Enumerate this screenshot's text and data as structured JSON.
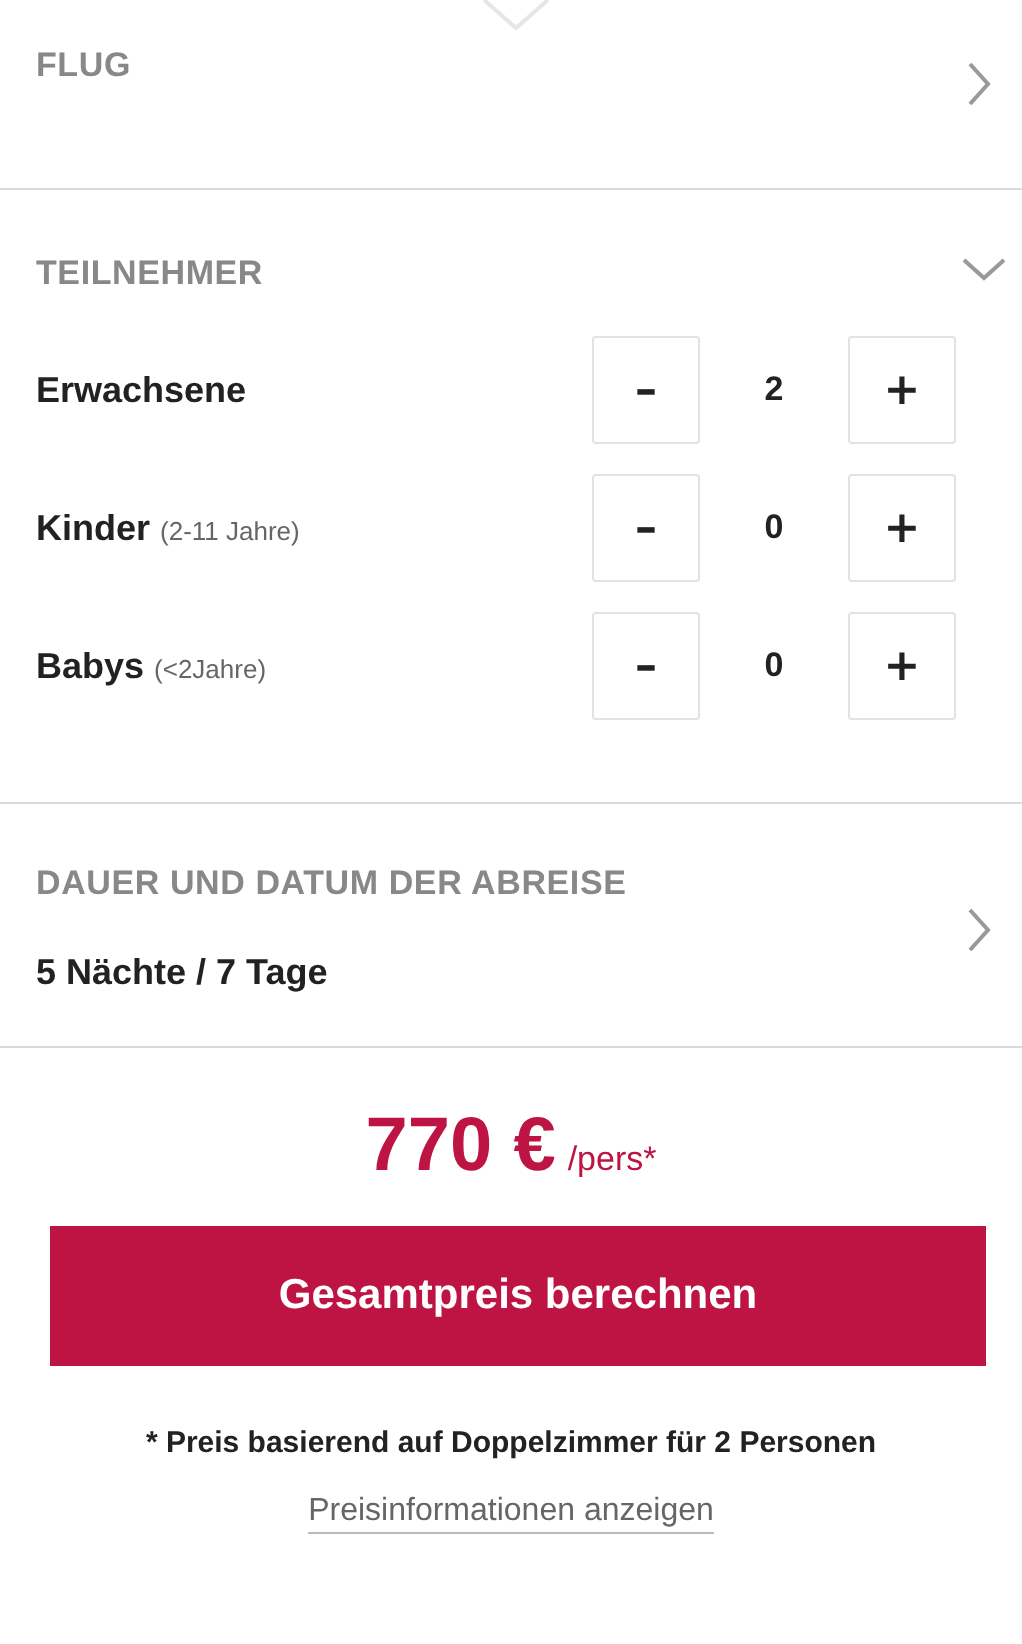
{
  "sections": [
    {
      "title": "FLUG",
      "expanded": false
    },
    {
      "title": "TEILNEHMER",
      "expanded": true,
      "participants": [
        {
          "label": "Erwachsene",
          "minus": "–",
          "count": "2",
          "plus": "+"
        },
        {
          "label": "Kinder",
          "note": "(2-11 Jahre)",
          "minus": "–",
          "count": "0",
          "plus": "+"
        },
        {
          "label": "Babys",
          "note": "(<2Jahre)",
          "minus": "–",
          "count": "0",
          "plus": "+"
        }
      ]
    },
    {
      "title": "DAUER UND DATUM DER ABREISE",
      "expanded": false,
      "value": "5 Nächte / 7 Tage"
    }
  ],
  "price": {
    "amount": "770 €",
    "unit": "/pers*"
  },
  "button": "Gesamtpreis berechnen",
  "footnote": "* Preis basierend auf Doppelzimmer für 2 Personen",
  "link": "Preisinformationen anzeigen"
}
